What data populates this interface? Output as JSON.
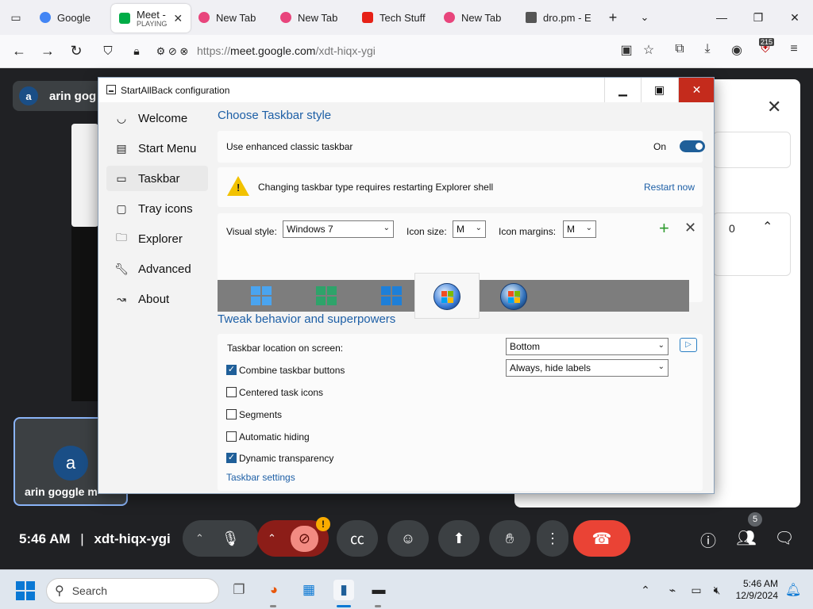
{
  "browser": {
    "tabs": [
      {
        "label": "Google",
        "sub": "",
        "color": "#4285f4"
      },
      {
        "label": "Meet - ",
        "sub": "PLAYING",
        "color": "#00ac47"
      },
      {
        "label": "New Tab",
        "sub": "",
        "color": "#e8457c"
      },
      {
        "label": "New Tab",
        "sub": "",
        "color": "#e8457c"
      },
      {
        "label": "Tech Stuff",
        "sub": "",
        "color": "#e62117"
      },
      {
        "label": "New Tab",
        "sub": "",
        "color": "#e8457c"
      },
      {
        "label": "dro.pm - E",
        "sub": "",
        "color": "#555555"
      }
    ],
    "url_prefix": "https://",
    "url_host": "meet.google.com",
    "url_path": "/xdt-hiqx-ygi",
    "extension_badge": "215"
  },
  "meet": {
    "chip_initial": "a",
    "chip_name": "arin gog",
    "self_initial": "a",
    "self_name": "arin goggle m",
    "time": "5:46 AM",
    "separator": "|",
    "code": "xdt-hiqx-ygi",
    "people_count": "5",
    "panel_value": "0"
  },
  "dialog": {
    "title": "StartAllBack configuration",
    "nav": [
      {
        "label": "Welcome",
        "icon": "smile-icon"
      },
      {
        "label": "Start Menu",
        "icon": "start-menu-icon"
      },
      {
        "label": "Taskbar",
        "icon": "taskbar-icon"
      },
      {
        "label": "Tray icons",
        "icon": "tray-icon"
      },
      {
        "label": "Explorer",
        "icon": "folder-icon"
      },
      {
        "label": "Advanced",
        "icon": "wrench-icon"
      },
      {
        "label": "About",
        "icon": "about-icon"
      }
    ],
    "section1": "Choose Taskbar style",
    "enhanced_label": "Use enhanced classic taskbar",
    "toggle_state": "On",
    "warning_text": "Changing taskbar type requires restarting Explorer shell",
    "restart_link": "Restart now",
    "visual_style_label": "Visual style:",
    "visual_style_value": "Windows 7",
    "icon_size_label": "Icon size:",
    "icon_size_value": "M",
    "icon_margins_label": "Icon margins:",
    "icon_margins_value": "M",
    "section2": "Tweak behavior and superpowers",
    "location_label": "Taskbar location on screen:",
    "location_value": "Bottom",
    "combine_value": "Always, hide labels",
    "options": [
      {
        "label": "Combine taskbar buttons",
        "checked": true
      },
      {
        "label": "Centered task icons",
        "checked": false
      },
      {
        "label": "Segments",
        "checked": false
      },
      {
        "label": "Automatic hiding",
        "checked": false
      },
      {
        "label": "Dynamic transparency",
        "checked": true
      }
    ],
    "settings_link": "Taskbar settings"
  },
  "taskbar": {
    "search_placeholder": "Search",
    "time": "5:46 AM",
    "date": "12/9/2024"
  },
  "colors": {
    "accent": "#1d5fa6",
    "close_red": "#c42b1c",
    "end_call": "#ea4335"
  }
}
